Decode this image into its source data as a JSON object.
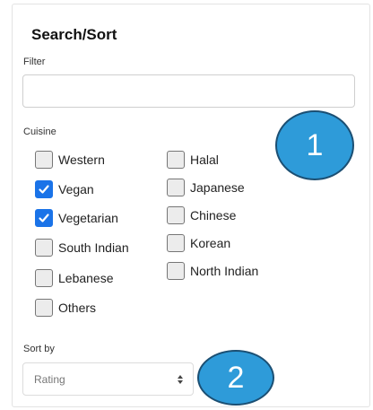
{
  "panel": {
    "title": "Search/Sort",
    "filter_label": "Filter",
    "filter_value": "",
    "filter_placeholder": "",
    "cuisine_label": "Cuisine",
    "cuisines_left": [
      {
        "label": "Western",
        "checked": false
      },
      {
        "label": "Vegan",
        "checked": true
      },
      {
        "label": "Vegetarian",
        "checked": true
      },
      {
        "label": "South Indian",
        "checked": false
      },
      {
        "label": "Lebanese",
        "checked": false
      },
      {
        "label": "Others",
        "checked": false
      }
    ],
    "cuisines_right": [
      {
        "label": "Halal",
        "checked": false
      },
      {
        "label": "Japanese",
        "checked": false
      },
      {
        "label": "Chinese",
        "checked": false
      },
      {
        "label": "Korean",
        "checked": false
      },
      {
        "label": "North Indian",
        "checked": false
      }
    ],
    "sort_label": "Sort by",
    "sort_value": "Rating"
  },
  "annotations": {
    "badge_1": "1",
    "badge_2": "2",
    "badge_color": "#2e9bd9"
  },
  "colors": {
    "checkbox_checked": "#1a73e8"
  }
}
